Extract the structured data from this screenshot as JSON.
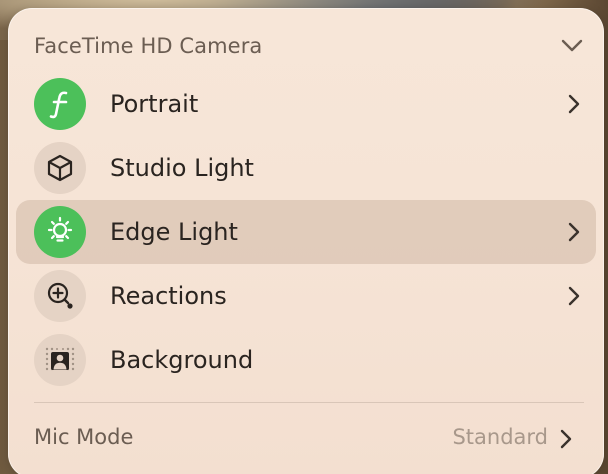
{
  "header": {
    "title": "FaceTime HD Camera",
    "collapse_icon": "chevron-down-icon"
  },
  "items": [
    {
      "label": "Portrait",
      "icon": "portrait-f-icon",
      "active": true,
      "has_submenu": true
    },
    {
      "label": "Studio Light",
      "icon": "cube-icon",
      "active": false,
      "has_submenu": false
    },
    {
      "label": "Edge Light",
      "icon": "sun-light-icon",
      "active": true,
      "has_submenu": true,
      "highlighted": true
    },
    {
      "label": "Reactions",
      "icon": "reactions-zoom-icon",
      "active": false,
      "has_submenu": true
    },
    {
      "label": "Background",
      "icon": "background-person-icon",
      "active": false,
      "has_submenu": false
    }
  ],
  "footer": {
    "label": "Mic Mode",
    "value": "Standard"
  },
  "colors": {
    "active_green": "#4cc05a",
    "panel": "#f6e4d6",
    "highlight": "#d0b8a6",
    "text": "#2a2420",
    "secondary_text": "#6b5d52",
    "muted_text": "#a8988b"
  }
}
